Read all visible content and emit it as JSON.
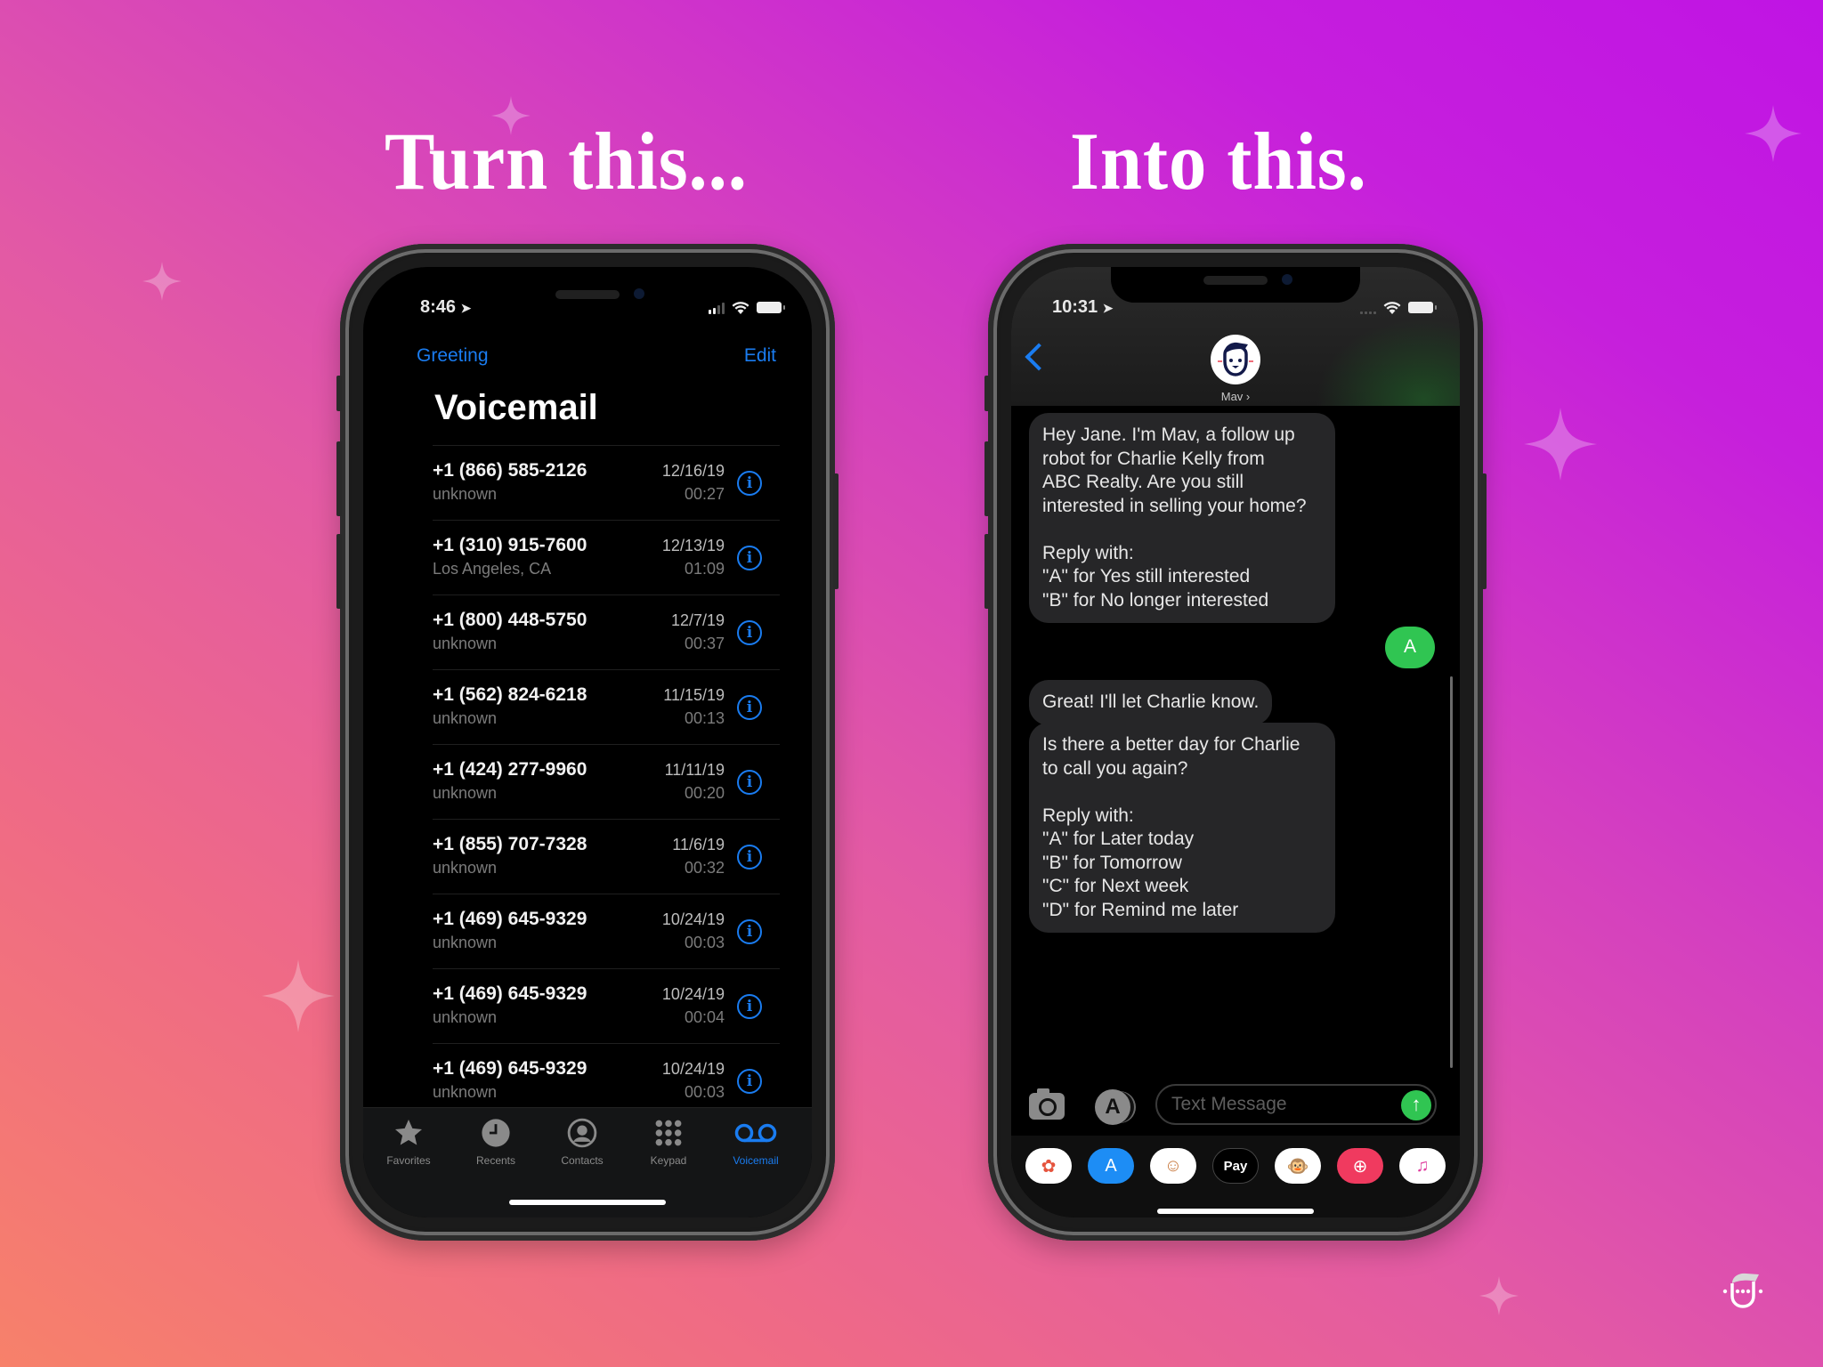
{
  "headlines": {
    "left": "Turn this...",
    "right": "Into this."
  },
  "brand_logo": "robot-face-logo",
  "phone_left": {
    "status": {
      "time": "8:46",
      "location_icon": "location-arrow-icon"
    },
    "nav": {
      "left_link": "Greeting",
      "right_link": "Edit"
    },
    "title": "Voicemail",
    "voicemails": [
      {
        "number": "+1 (866) 585-2126",
        "label": "unknown",
        "date": "12/16/19",
        "duration": "00:27"
      },
      {
        "number": "+1 (310) 915-7600",
        "label": "Los Angeles, CA",
        "date": "12/13/19",
        "duration": "01:09"
      },
      {
        "number": "+1 (800) 448-5750",
        "label": "unknown",
        "date": "12/7/19",
        "duration": "00:37"
      },
      {
        "number": "+1 (562) 824-6218",
        "label": "unknown",
        "date": "11/15/19",
        "duration": "00:13"
      },
      {
        "number": "+1 (424) 277-9960",
        "label": "unknown",
        "date": "11/11/19",
        "duration": "00:20"
      },
      {
        "number": "+1 (855) 707-7328",
        "label": "unknown",
        "date": "11/6/19",
        "duration": "00:32"
      },
      {
        "number": "+1 (469) 645-9329",
        "label": "unknown",
        "date": "10/24/19",
        "duration": "00:03"
      },
      {
        "number": "+1 (469) 645-9329",
        "label": "unknown",
        "date": "10/24/19",
        "duration": "00:04"
      },
      {
        "number": "+1 (469) 645-9329",
        "label": "unknown",
        "date": "10/24/19",
        "duration": "00:03"
      }
    ],
    "info_glyph": "i",
    "tabs": [
      {
        "label": "Favorites",
        "icon": "star-icon",
        "active": false
      },
      {
        "label": "Recents",
        "icon": "clock-icon",
        "active": false
      },
      {
        "label": "Contacts",
        "icon": "person-circle-icon",
        "active": false
      },
      {
        "label": "Keypad",
        "icon": "keypad-icon",
        "active": false
      },
      {
        "label": "Voicemail",
        "icon": "voicemail-icon",
        "active": true
      }
    ]
  },
  "phone_right": {
    "status": {
      "time": "10:31"
    },
    "contact": {
      "name": "Mav ›"
    },
    "messages": [
      {
        "from": "them",
        "text": "Hey Jane. I'm Mav, a follow up\nrobot for Charlie Kelly from\nABC Realty. Are you still\ninterested in selling your home?\n\nReply with:\n\"A\" for Yes still interested\n\"B\" for No longer interested"
      },
      {
        "from": "me",
        "text": "A"
      },
      {
        "from": "them",
        "text": "Great! I'll let Charlie know."
      },
      {
        "from": "them",
        "text": "Is there a better day for Charlie\nto call you again?\n\nReply with:\n\"A\" for Later today\n\"B\" for Tomorrow\n\"C\" for Next week\n\"D\" for Remind me later"
      }
    ],
    "composer": {
      "placeholder": "Text Message",
      "value": "",
      "send_glyph": "↑",
      "apps_glyph": "A"
    },
    "app_strip": [
      {
        "name": "photos-app-icon",
        "glyph": "✿",
        "bg": "#ffffff",
        "fg": "#e5533d"
      },
      {
        "name": "app-store-icon",
        "glyph": "A",
        "bg": "#1d8df5",
        "fg": "#ffffff"
      },
      {
        "name": "memoji-icon",
        "glyph": "☺",
        "bg": "#ffffff",
        "fg": "#c97a3f"
      },
      {
        "name": "apple-pay-icon",
        "glyph": "Pay",
        "bg": "#000000",
        "fg": "#ffffff"
      },
      {
        "name": "animoji-monkey-icon",
        "glyph": "🐵",
        "bg": "#ffffff",
        "fg": "#b07a4a"
      },
      {
        "name": "search-images-icon",
        "glyph": "⊕",
        "bg": "#f03a5f",
        "fg": "#ffffff"
      },
      {
        "name": "music-app-icon",
        "glyph": "♫",
        "bg": "#ffffff",
        "fg": "#e040a0"
      }
    ]
  },
  "colors": {
    "ios_blue": "#1a7cf0",
    "imessage_green": "#30c552",
    "bubble_gray": "#262628"
  }
}
